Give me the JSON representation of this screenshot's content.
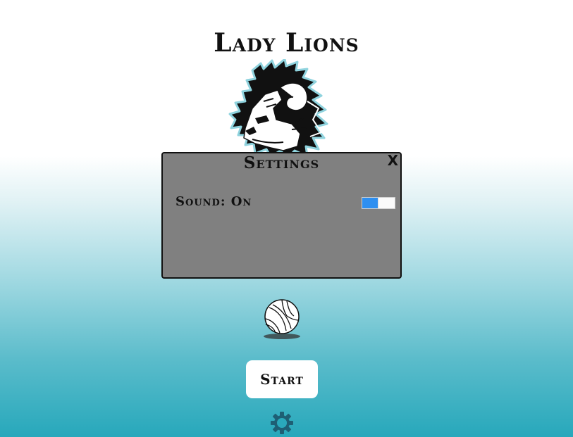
{
  "title": "Lady Lions",
  "logo": {
    "icon": "lion-head-icon"
  },
  "settings_dialog": {
    "title": "Settings",
    "close_label": "X",
    "sound_label": "Sound: On",
    "sound_enabled": true
  },
  "ball": {
    "icon": "volleyball-icon"
  },
  "start_button": {
    "label": "Start"
  },
  "settings_button": {
    "icon": "gear-icon"
  },
  "colors": {
    "dialog_bg": "#808080",
    "toggle_on": "#2e8ff0",
    "gradient_bottom": "#27a8bb",
    "gear": "#1e5f74"
  }
}
